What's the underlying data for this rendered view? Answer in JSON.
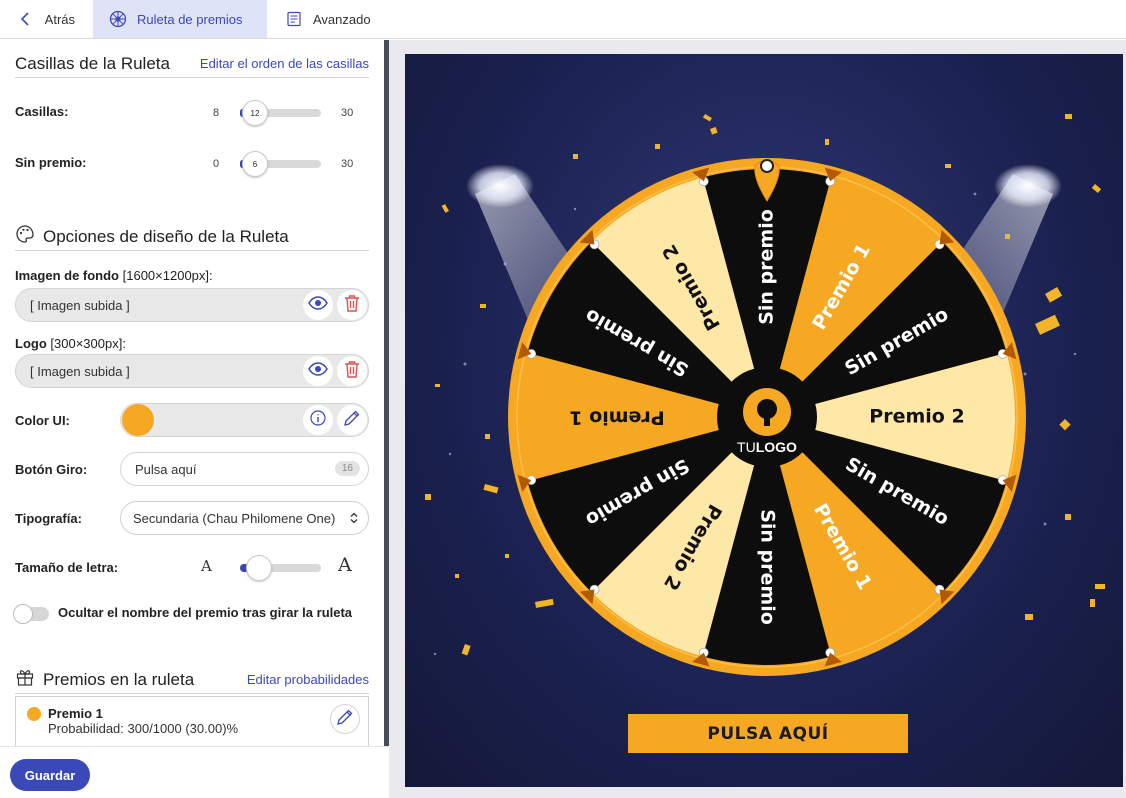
{
  "tabs": [
    {
      "label": "Atrás",
      "icon": "chevron-left-icon"
    },
    {
      "label": "Ruleta de premios",
      "icon": "wheel-icon",
      "active": true
    },
    {
      "label": "Avanzado",
      "icon": "document-icon"
    }
  ],
  "slots_section": {
    "title": "Casillas de la Ruleta",
    "edit_link": "Editar el orden de las casillas",
    "casillas": {
      "label": "Casillas:",
      "min": "8",
      "max": "30",
      "value": "12"
    },
    "sin_premio": {
      "label": "Sin premio:",
      "min": "0",
      "max": "30",
      "value": "6"
    }
  },
  "design_section": {
    "title": "Opciones de diseño de la Ruleta",
    "background": {
      "label": "Imagen de fondo",
      "size": "[1600×1200px]:",
      "value": "[ Imagen subida ]"
    },
    "logo": {
      "label": "Logo",
      "size": "[300×300px]:",
      "value": "[ Imagen subida ]"
    },
    "color_ui": {
      "label": "Color UI:",
      "color": "#f7a823"
    },
    "spin_button": {
      "label": "Botón Giro:",
      "value": "Pulsa aquí",
      "count": "16"
    },
    "typography": {
      "label": "Tipografía:",
      "value": "Secundaria (Chau Philomene One)"
    },
    "font_size": {
      "label": "Tamaño de letra:",
      "small_glyph": "A",
      "large_glyph": "A",
      "level": 0.1
    },
    "hide_toggle": {
      "label": "Ocultar el nombre del premio tras girar la ruleta",
      "on": false
    }
  },
  "prizes_section": {
    "title": "Premios en la ruleta",
    "edit_link": "Editar probabilidades",
    "items": [
      {
        "name": "Premio 1",
        "probability": "Probabilidad: 300/1000 (30.00)%",
        "color": "#f7a823"
      }
    ]
  },
  "footer": {
    "save_label": "Guardar"
  },
  "preview": {
    "logo_text_light": "TU",
    "logo_text_bold": "LOGO",
    "cta_label": "PULSA AQUÍ",
    "segments": [
      {
        "label": "Sin premio",
        "fill": "#0d0d0d",
        "text": "#ffffff"
      },
      {
        "label": "Premio 1",
        "fill": "#f7a823",
        "text": "#ffffff"
      },
      {
        "label": "Sin premio",
        "fill": "#0d0d0d",
        "text": "#ffffff"
      },
      {
        "label": "Premio 2",
        "fill": "#fde8a8",
        "text": "#111111"
      },
      {
        "label": "Sin premio",
        "fill": "#0d0d0d",
        "text": "#ffffff"
      },
      {
        "label": "Premio 1",
        "fill": "#f7a823",
        "text": "#ffffff"
      },
      {
        "label": "Sin premio",
        "fill": "#0d0d0d",
        "text": "#ffffff"
      },
      {
        "label": "Premio 2",
        "fill": "#fde8a8",
        "text": "#111111"
      },
      {
        "label": "Sin premio",
        "fill": "#0d0d0d",
        "text": "#ffffff"
      },
      {
        "label": "Premio 1",
        "fill": "#f7a823",
        "text": "#111111"
      },
      {
        "label": "Sin premio",
        "fill": "#0d0d0d",
        "text": "#ffffff"
      },
      {
        "label": "Premio 2",
        "fill": "#fde8a8",
        "text": "#111111"
      }
    ]
  },
  "colors": {
    "accent": "#3b48b8",
    "wheel_rim": "#f7a823",
    "danger": "#e05050"
  }
}
